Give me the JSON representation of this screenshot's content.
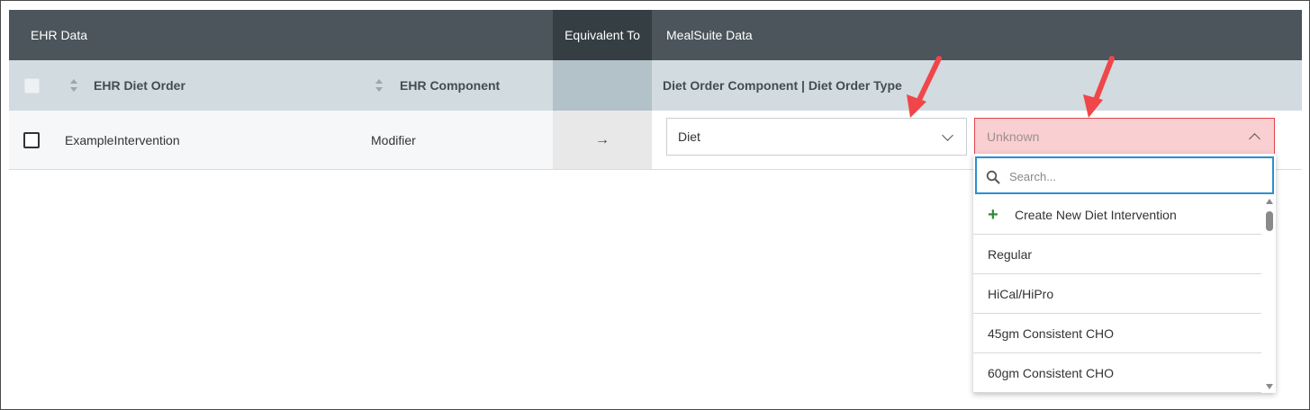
{
  "header": {
    "ehr_data": "EHR Data",
    "equivalent_to": "Equivalent To",
    "mealsuite_data": "MealSuite Data"
  },
  "subheader": {
    "ehr_diet_order": "EHR Diet Order",
    "ehr_component": "EHR Component",
    "mealsuite_columns": "Diet Order Component | Diet Order Type"
  },
  "row": {
    "ehr_diet_order": "ExampleIntervention",
    "ehr_component": "Modifier",
    "arrow": "→",
    "component_select": "Diet",
    "type_select": "Unknown"
  },
  "dropdown": {
    "search_placeholder": "Search...",
    "create_label": "Create New Diet Intervention",
    "items": [
      "Regular",
      "HiCal/HiPro",
      "45gm Consistent CHO",
      "60gm Consistent CHO"
    ]
  },
  "colors": {
    "header_bg": "#4b555b",
    "equivalent_header_bg": "#353e43",
    "subheader_bg": "#d1dbe0",
    "error_bg": "#f9cfd1",
    "error_border": "#e0454b",
    "focus_border": "#2b8fd0",
    "plus_green": "#2e8b3a",
    "annotation_arrow": "#f0464a"
  }
}
